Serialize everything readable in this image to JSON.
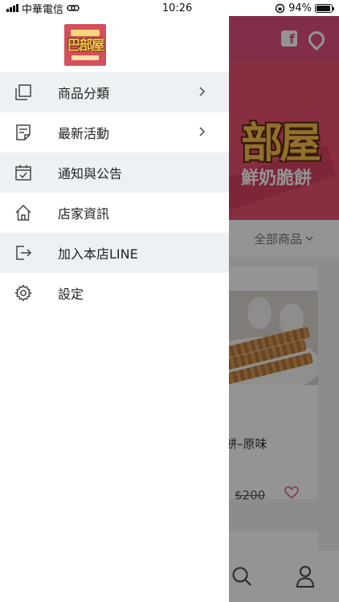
{
  "status_bar": {
    "carrier": "中華電信",
    "time": "10:26",
    "battery": "94%",
    "battery_level": 0.94
  },
  "drawer": {
    "logo_alt": "巴部屋",
    "menu": [
      {
        "label": "商品分類",
        "icon": "copy-icon",
        "has_chevron": true
      },
      {
        "label": "最新活動",
        "icon": "note-icon",
        "has_chevron": true
      },
      {
        "label": "通知與公告",
        "icon": "calendar-check-icon",
        "has_chevron": false
      },
      {
        "label": "店家資訊",
        "icon": "home-icon",
        "has_chevron": false
      },
      {
        "label": "加入本店LINE",
        "icon": "sign-out-icon",
        "has_chevron": false
      },
      {
        "label": "設定",
        "icon": "gear-icon",
        "has_chevron": false
      }
    ]
  },
  "background_app": {
    "header_icons": [
      "facebook-icon",
      "location-icon"
    ],
    "banner_text": "部屋",
    "banner_subtitle": "鮮奶脆餅",
    "filter_label": "全部商品",
    "product": {
      "name": "餅–原味",
      "price": "$200"
    },
    "bottom_icons": [
      "search-icon",
      "user-icon"
    ]
  },
  "colors": {
    "brand_pink": "#e2507d",
    "drawer_row_shade": "#eef1f3",
    "logo_yellow": "#f8c14a"
  }
}
